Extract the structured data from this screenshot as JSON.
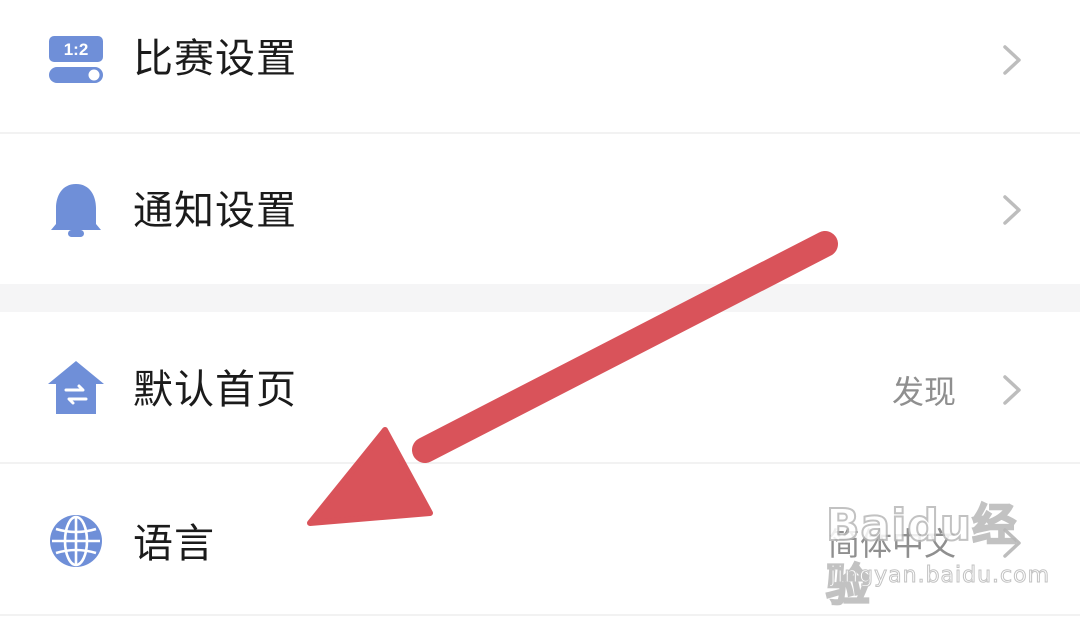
{
  "settings": {
    "items": [
      {
        "label": "比赛设置",
        "value": "",
        "icon": "scoreboard-toggle-icon"
      },
      {
        "label": "通知设置",
        "value": "",
        "icon": "bell-icon"
      },
      {
        "label": "默认首页",
        "value": "发现",
        "icon": "home-switch-icon"
      },
      {
        "label": "语言",
        "value": "简体中文",
        "icon": "globe-icon"
      }
    ],
    "match_icon_text": "1:2"
  },
  "watermark": {
    "logo": "Baidu经验",
    "url": "jingyan.baidu.com"
  },
  "annotation": {
    "arrow_color": "#d9535a"
  },
  "theme": {
    "icon_color": "#6f8fd8",
    "label_color": "#1b1b1b",
    "value_color": "#8f8f8f",
    "chevron_color": "#bdbdbd"
  }
}
